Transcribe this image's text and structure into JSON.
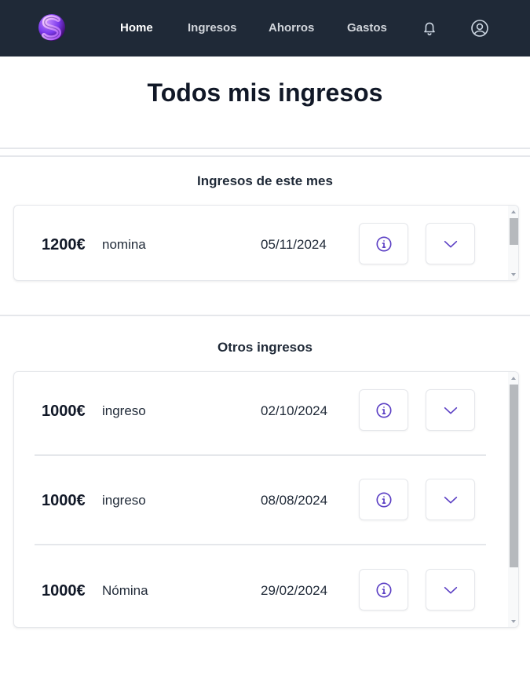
{
  "navbar": {
    "logo_letter": "S",
    "links": [
      {
        "label": "Home"
      },
      {
        "label": "Ingresos"
      },
      {
        "label": "Ahorros"
      },
      {
        "label": "Gastos"
      }
    ],
    "icons": [
      "bell-icon",
      "user-circle-icon"
    ],
    "background": "#1f2937",
    "accent": "#7c3aed"
  },
  "page": {
    "title": "Todos mis ingresos"
  },
  "this_month": {
    "title": "Ingresos de este mes",
    "items": [
      {
        "amount": "1200€",
        "concept": "nomina",
        "date": "05/11/2024"
      }
    ]
  },
  "others": {
    "title": "Otros ingresos",
    "items": [
      {
        "amount": "1000€",
        "concept": "ingreso",
        "date": "02/10/2024"
      },
      {
        "amount": "1000€",
        "concept": "ingreso",
        "date": "08/08/2024"
      },
      {
        "amount": "1000€",
        "concept": "Nómina",
        "date": "29/02/2024"
      }
    ]
  },
  "row_icons": [
    "info-icon",
    "chevron-down-icon"
  ],
  "icon_color": "#5b3fc4"
}
